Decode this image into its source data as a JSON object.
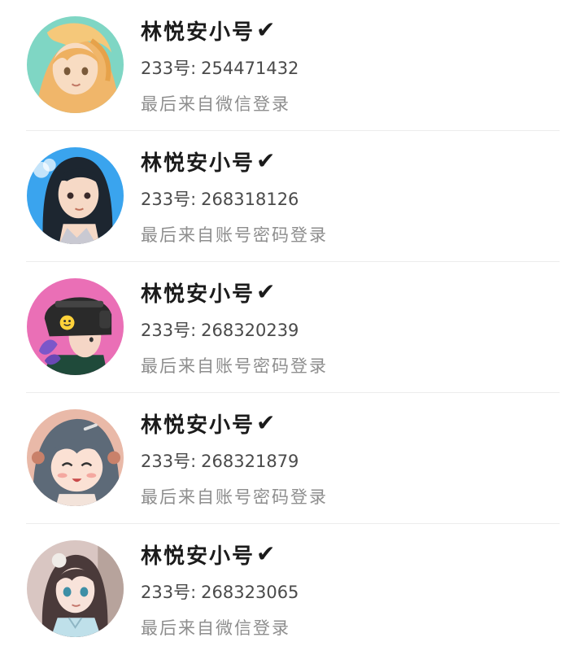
{
  "accounts": [
    {
      "name": "林悦安小号",
      "verified_glyph": "✔",
      "id_label": "233号:",
      "id_value": "254471432",
      "login_method": "最后来自微信登录",
      "avatar_icon": "anime-girl-blonde-avatar"
    },
    {
      "name": "林悦安小号",
      "verified_glyph": "✔",
      "id_label": "233号:",
      "id_value": "268318126",
      "login_method": "最后来自账号密码登录",
      "avatar_icon": "anime-girl-black-hair-avatar"
    },
    {
      "name": "林悦安小号",
      "verified_glyph": "✔",
      "id_label": "233号:",
      "id_value": "268320239",
      "login_method": "最后来自账号密码登录",
      "avatar_icon": "helmet-girl-pink-avatar"
    },
    {
      "name": "林悦安小号",
      "verified_glyph": "✔",
      "id_label": "233号:",
      "id_value": "268321879",
      "login_method": "最后来自账号密码登录",
      "avatar_icon": "chibi-girl-gray-hair-avatar"
    },
    {
      "name": "林悦安小号",
      "verified_glyph": "✔",
      "id_label": "233号:",
      "id_value": "268323065",
      "login_method": "最后来自微信登录",
      "avatar_icon": "anime-girl-qipao-avatar"
    }
  ],
  "colors": {
    "name_text": "#1b1b1b",
    "id_text": "#4a4a4a",
    "login_text": "#8e8e8e",
    "divider": "#ececec"
  }
}
